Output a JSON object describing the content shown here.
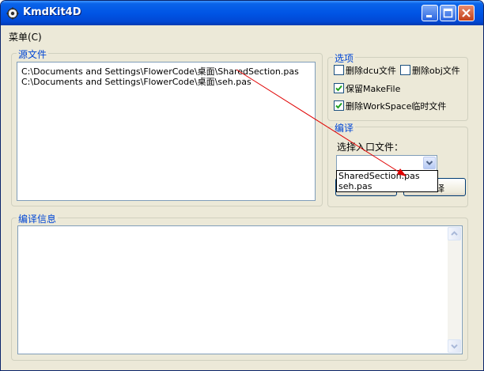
{
  "window": {
    "title": "KmdKit4D"
  },
  "menu": {
    "label": "菜单(C)"
  },
  "source": {
    "title": "源文件",
    "files": [
      "C:\\Documents and Settings\\FlowerCode\\桌面\\SharedSection.pas",
      "C:\\Documents and Settings\\FlowerCode\\桌面\\seh.pas"
    ]
  },
  "options": {
    "title": "选项",
    "delete_dcu": {
      "label": "删除dcu文件",
      "checked": false
    },
    "delete_obj": {
      "label": "删除obj文件",
      "checked": false
    },
    "keep_makefile": {
      "label": "保留MakeFile",
      "checked": true
    },
    "delete_workspace": {
      "label": "删除WorkSpace临时文件",
      "checked": true
    }
  },
  "compile": {
    "title": "编译",
    "entry_label": "选择入口文件：",
    "entry_value": "",
    "dropdown_options": [
      "SharedSection.pas",
      "seh.pas"
    ],
    "button_right_label": "译"
  },
  "info": {
    "title": "编译信息",
    "text": ""
  },
  "icons": {
    "app": "gear-icon",
    "minimize": "minimize-icon",
    "maximize": "maximize-icon",
    "close": "close-icon",
    "combo": "chevron-down-icon",
    "scroll_up": "scroll-up-arrow-icon",
    "scroll_down": "scroll-down-arrow-icon"
  },
  "colors": {
    "titlebar": "#0055e5",
    "group_title": "#0046d5",
    "annotation_arrow": "#e00000"
  }
}
